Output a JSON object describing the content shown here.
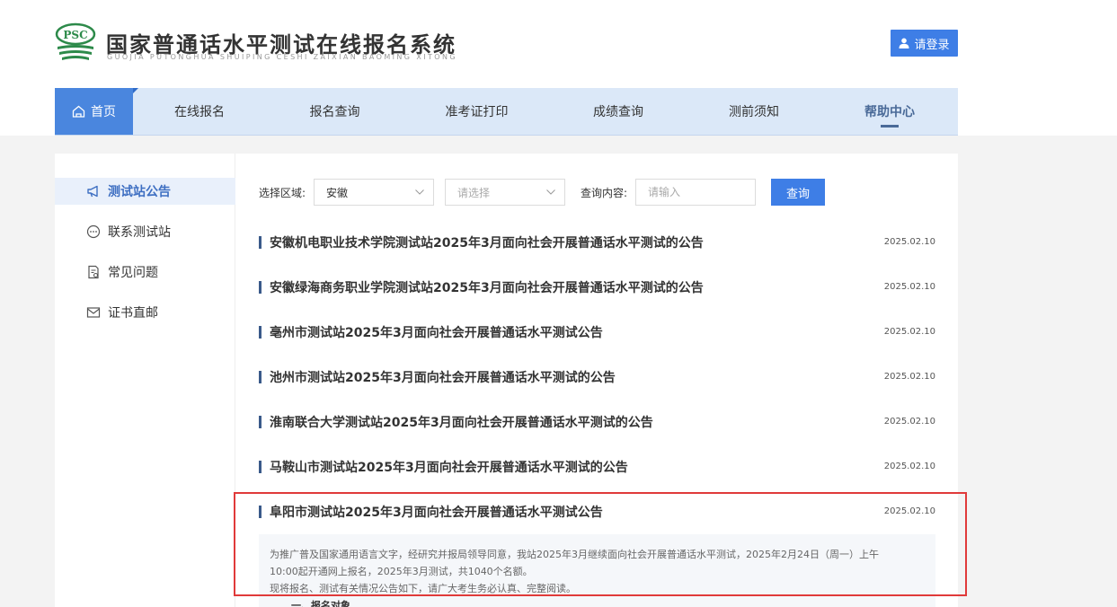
{
  "header": {
    "logo_text": "PSC",
    "title": "国家普通话水平测试在线报名系统",
    "subtitle": "GUOJIA PUTONGHUA SHUIPING CESHI ZAIXIAN BAOMING XITONG",
    "login_label": "请登录"
  },
  "nav": {
    "items": [
      {
        "label": "首页"
      },
      {
        "label": "在线报名"
      },
      {
        "label": "报名查询"
      },
      {
        "label": "准考证打印"
      },
      {
        "label": "成绩查询"
      },
      {
        "label": "测前须知"
      },
      {
        "label": "帮助中心"
      }
    ]
  },
  "sidebar": {
    "items": [
      {
        "label": "测试站公告",
        "icon": "megaphone-icon"
      },
      {
        "label": "联系测试站",
        "icon": "chat-icon"
      },
      {
        "label": "常见问题",
        "icon": "faq-icon"
      },
      {
        "label": "证书直邮",
        "icon": "mail-icon"
      }
    ]
  },
  "filters": {
    "region_label": "选择区域:",
    "region_value": "安徽",
    "second_placeholder": "请选择",
    "query_label": "查询内容:",
    "query_placeholder": "请输入",
    "query_button": "查询"
  },
  "announcements": [
    {
      "title": "安徽机电职业技术学院测试站2025年3月面向社会开展普通话水平测试的公告",
      "date": "2025.02.10"
    },
    {
      "title": "安徽绿海商务职业学院测试站2025年3月面向社会开展普通话水平测试的公告",
      "date": "2025.02.10"
    },
    {
      "title": "亳州市测试站2025年3月面向社会开展普通话水平测试公告",
      "date": "2025.02.10"
    },
    {
      "title": "池州市测试站2025年3月面向社会开展普通话水平测试的公告",
      "date": "2025.02.10"
    },
    {
      "title": "淮南联合大学测试站2025年3月面向社会开展普通话水平测试的公告",
      "date": "2025.02.10"
    },
    {
      "title": "马鞍山市测试站2025年3月面向社会开展普通话水平测试的公告",
      "date": "2025.02.10"
    },
    {
      "title": "阜阳市测试站2025年3月面向社会开展普通话水平测试公告",
      "date": "2025.02.10"
    }
  ],
  "detail": {
    "line1": "为推广普及国家通用语言文字，经研究并报局领导同意，我站2025年3月继续面向社会开展普通话水平测试，2025年2月24日（周一）上午",
    "line2": "10:00起开通网上报名，2025年3月测试，共1040个名额。",
    "line3": "现将报名、测试有关情况公告如下，请广大考生务必认真、完整阅读。",
    "line4": "一、报名对象"
  },
  "colors": {
    "accent": "#3e7ee6",
    "nav_bg": "#dbe8f8",
    "highlight": "#e03a3a"
  }
}
